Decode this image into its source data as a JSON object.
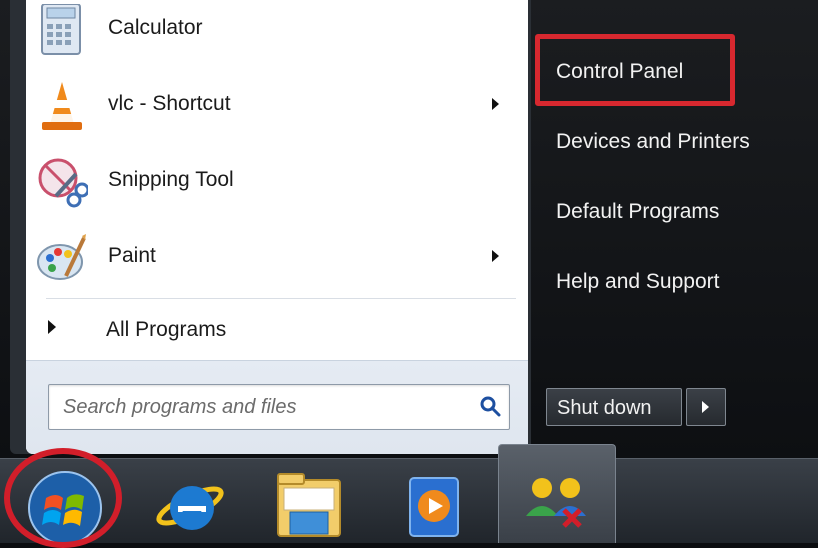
{
  "programs": [
    {
      "label": "Calculator",
      "icon": "calculator-icon",
      "has_submenu": false
    },
    {
      "label": "vlc - Shortcut",
      "icon": "vlc-cone-icon",
      "has_submenu": true
    },
    {
      "label": "Snipping Tool",
      "icon": "snipping-tool-icon",
      "has_submenu": false
    },
    {
      "label": "Paint",
      "icon": "paint-palette-icon",
      "has_submenu": true
    }
  ],
  "all_programs_label": "All Programs",
  "search": {
    "placeholder": "Search programs and files",
    "value": ""
  },
  "right_pane": {
    "items": [
      "Control Panel",
      "Devices and Printers",
      "Default Programs",
      "Help and Support"
    ],
    "highlighted": "Control Panel"
  },
  "shutdown": {
    "label": "Shut down"
  },
  "taskbar": {
    "items": [
      "start-orb-icon",
      "internet-explorer-icon",
      "windows-explorer-icon",
      "media-player-icon",
      "users-icon"
    ],
    "highlighted": "start-orb-icon"
  },
  "colors": {
    "highlight": "#d7282f",
    "menu_dark": "#0d0f12",
    "taskbar": "#20252b"
  }
}
